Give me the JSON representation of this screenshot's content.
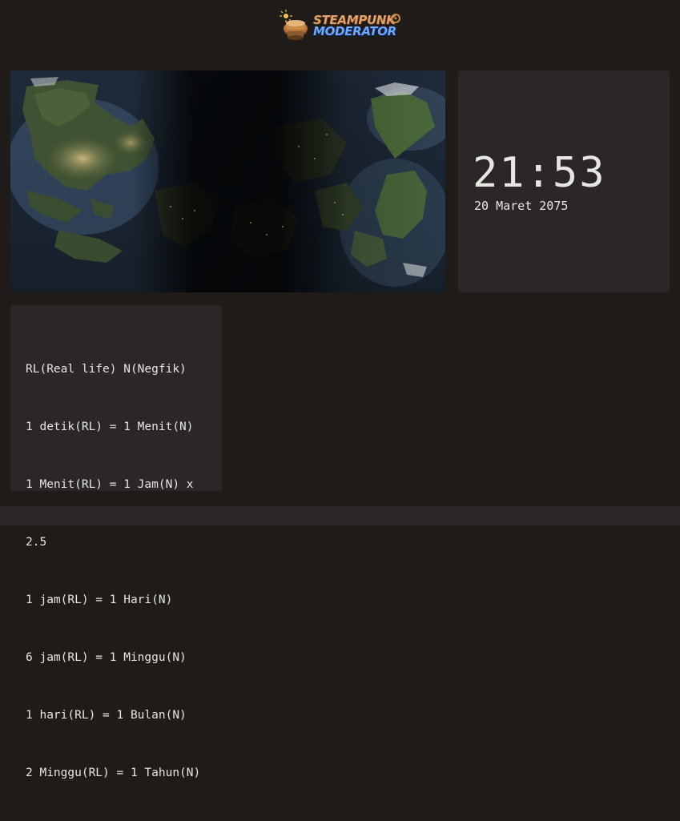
{
  "header": {
    "logo_line1": "STEAMPUNK",
    "logo_line2": "MODERATOR"
  },
  "world_map": {
    "icon": "world-map-image"
  },
  "clock": {
    "time": "21:53",
    "date": "20 Maret 2075"
  },
  "conversion": {
    "lines": [
      "RL(Real life) N(Negfik)",
      "1 detik(RL) = 1 Menit(N)",
      "1 Menit(RL) = 1 Jam(N) x",
      "2.5",
      "1 jam(RL) = 1 Hari(N)",
      "6 jam(RL) = 1 Minggu(N)",
      "1 hari(RL) = 1 Bulan(N)",
      "2 Minggu(RL) = 1 Tahun(N)"
    ]
  },
  "colors": {
    "background": "#1e1b18",
    "panel": "#2a2726",
    "text": "#e8e6e3",
    "logo_orange": "#e0a36a",
    "logo_blue": "#6fa8ff"
  }
}
